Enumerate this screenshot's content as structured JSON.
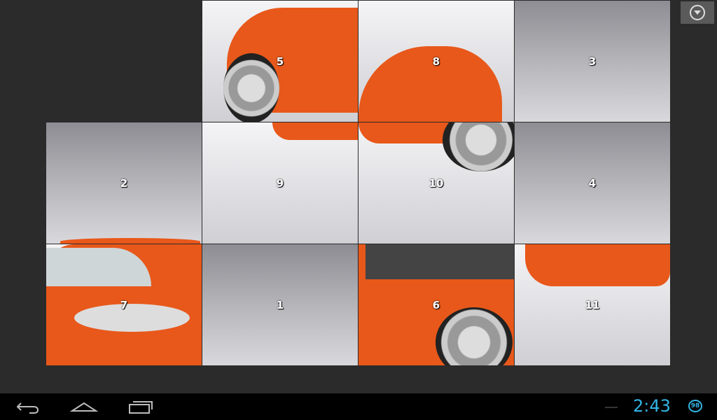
{
  "puzzle": {
    "grid": {
      "rows": 3,
      "cols": 4
    },
    "empty_cell": {
      "row": 0,
      "col": 0
    },
    "tiles": [
      {
        "label": "5",
        "row": 0,
        "col": 1
      },
      {
        "label": "8",
        "row": 0,
        "col": 2
      },
      {
        "label": "3",
        "row": 0,
        "col": 3
      },
      {
        "label": "2",
        "row": 1,
        "col": 0
      },
      {
        "label": "9",
        "row": 1,
        "col": 1
      },
      {
        "label": "10",
        "row": 1,
        "col": 2
      },
      {
        "label": "4",
        "row": 1,
        "col": 3
      },
      {
        "label": "7",
        "row": 2,
        "col": 0
      },
      {
        "label": "1",
        "row": 2,
        "col": 1
      },
      {
        "label": "6",
        "row": 2,
        "col": 2
      },
      {
        "label": "11",
        "row": 2,
        "col": 3
      }
    ],
    "car_color": "#e8581a"
  },
  "menu_button": {
    "icon": "dropdown-circle-icon"
  },
  "status_bar": {
    "time": "2:43",
    "battery": "98",
    "accent": "#33b5e5"
  },
  "nav_bar": {
    "back_icon": "back-icon",
    "home_icon": "home-icon",
    "recents_icon": "recent-apps-icon"
  }
}
